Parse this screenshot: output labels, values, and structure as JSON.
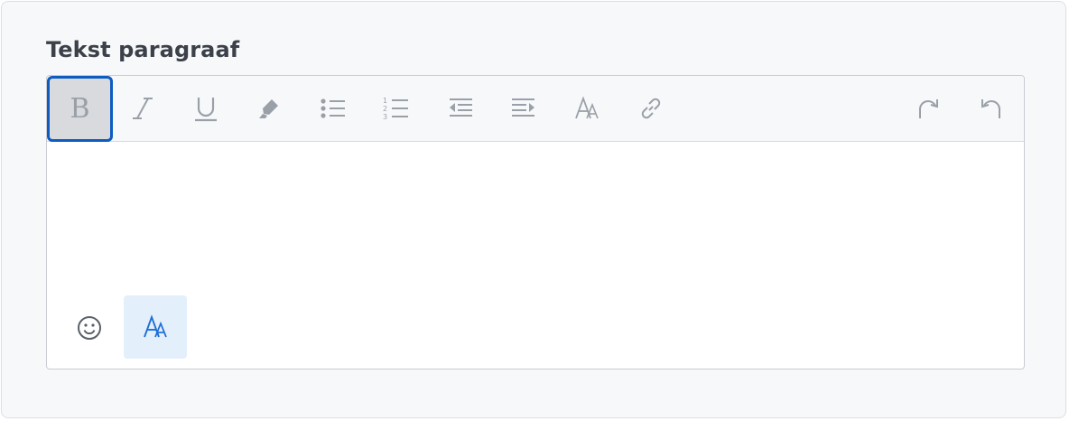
{
  "field": {
    "label": "Tekst paragraaf",
    "content": ""
  },
  "toolbar": {
    "bold_label": "B",
    "active_button": "bold",
    "buttons": [
      "bold",
      "italic-icon",
      "underline-icon",
      "highlighter-icon",
      "bulleted-list-icon",
      "numbered-list-icon",
      "outdent-icon",
      "indent-icon",
      "font-size-icon",
      "link-icon",
      "redo-icon",
      "undo-icon"
    ]
  },
  "bottom_bar": {
    "buttons": [
      "emoji-icon",
      "text-format-icon"
    ],
    "active_button": "text-format-icon"
  },
  "colors": {
    "accent": "#0d5cc2",
    "icon": "#9aa0a8",
    "active_icon": "#1f6fd6",
    "active_bg": "#e4effc"
  }
}
